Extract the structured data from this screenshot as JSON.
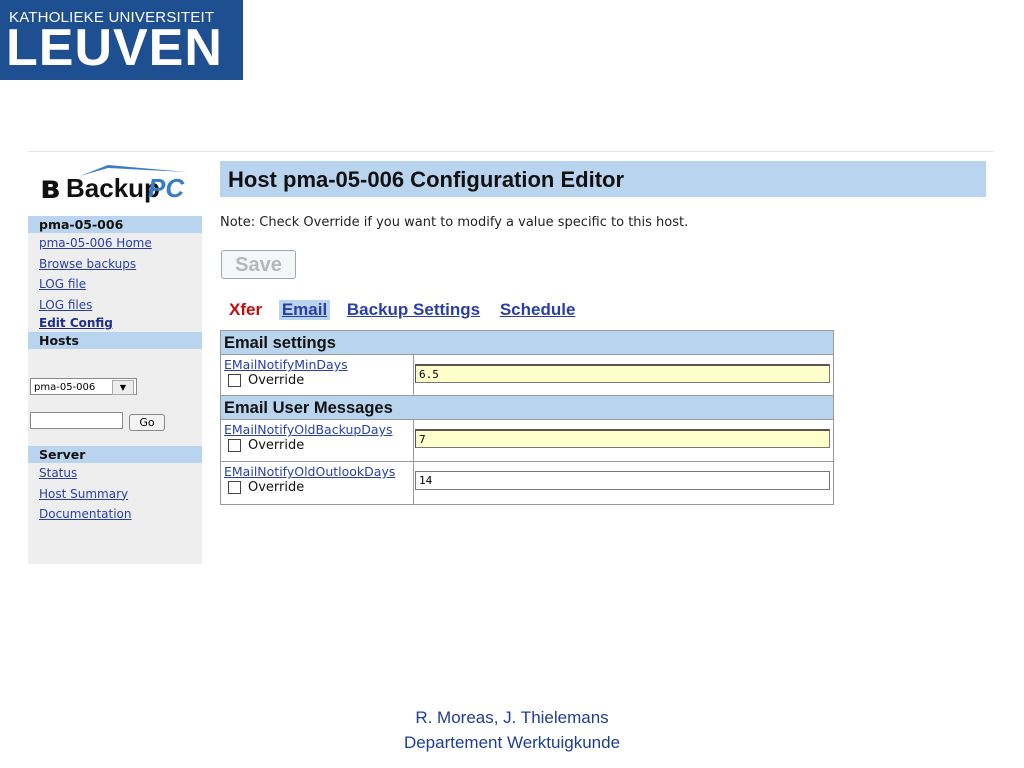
{
  "header_logo": {
    "small": "KATHOLIEKE UNIVERSITEIT",
    "big": "LEUVEN"
  },
  "app_logo": {
    "part1": "Backup",
    "part2": "PC"
  },
  "sidebar": {
    "host_heading": "pma-05-006",
    "host_links": [
      "pma-05-006 Home",
      "Browse backups",
      "LOG file",
      "LOG files"
    ],
    "edit_config": "Edit Config",
    "hosts_heading": "Hosts",
    "host_select_value": "pma-05-006",
    "go_label": "Go",
    "server_heading": "Server",
    "server_links": [
      "Status",
      "Host Summary",
      "Documentation"
    ]
  },
  "main": {
    "title": "Host pma-05-006 Configuration Editor",
    "note": "Note: Check Override if you want to modify a value specific to this host.",
    "save_label": "Save",
    "tabs": [
      "Xfer",
      "Email",
      "Backup Settings",
      "Schedule"
    ],
    "sections": [
      {
        "title": "Email settings",
        "rows": [
          {
            "name": "EMailNotifyMinDays",
            "override_label": "Override",
            "value": "6.5"
          }
        ]
      },
      {
        "title": "Email User Messages",
        "rows": [
          {
            "name": "EMailNotifyOldBackupDays",
            "override_label": "Override",
            "value": "7"
          },
          {
            "name": "EMailNotifyOldOutlookDays",
            "override_label": "Override",
            "value": "14"
          }
        ]
      }
    ]
  },
  "footer": {
    "line1": "R. Moreas, J. Thielemans",
    "line2": "Departement Werktuigkunde"
  },
  "colors": {
    "kul_blue": "#1d4f91",
    "header_blue": "#b9d4ee",
    "link_blue": "#2a3fa6",
    "active_tab_red": "#c40b0b",
    "field_yellow": "#ffffcc"
  }
}
